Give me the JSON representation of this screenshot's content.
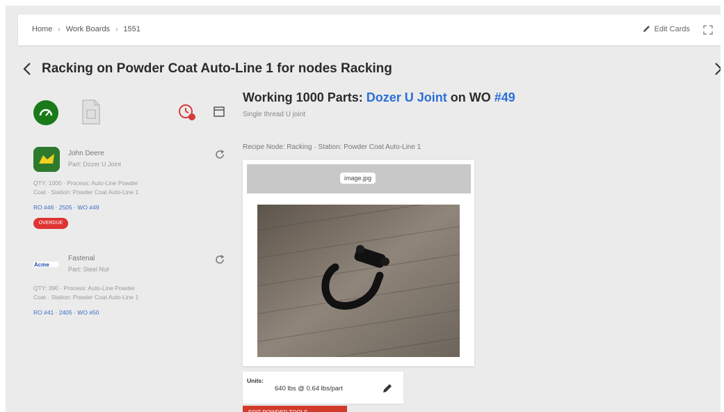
{
  "breadcrumb": {
    "home": "Home",
    "work_boards": "Work Boards",
    "board_id": "1551"
  },
  "header": {
    "edit_cards_label": "Edit Cards"
  },
  "title": "Racking on Powder Coat Auto-Line 1 for nodes Racking",
  "cards": [
    {
      "customer": "John Deere",
      "part": "Part: Dozer U Joint",
      "meta_line1": "QTY: 1000 · Process: Auto-Line Powder",
      "meta_line2": "Coat · Station: Powder Coat Auto-Line 1",
      "refs": "RO #46 · 2505 · WO #49",
      "badge": "OVERDUE"
    },
    {
      "customer": "Fastenal",
      "part": "Part: Steel Nut",
      "meta_line1": "QTY: 390 · Process: Auto-Line Powder",
      "meta_line2": "Coat · Station: Powder Coat Auto-Line 1",
      "refs": "RO #41 · 2405 · WO #50"
    }
  ],
  "main": {
    "heading_prefix": "Working 1000 Parts: ",
    "heading_part": "Dozer U Joint",
    "heading_mid": " on WO ",
    "heading_wo": "#49",
    "subtitle": "Single thread U joint",
    "recipe_line": "Recipe Node: Racking · Station: Powder Coat Auto-Line 1",
    "image_label": "image.jpg",
    "units_label": "Units:",
    "units_value": "640 lbs @ 0.64 lbs/part",
    "bottom_button": "EDIT POWDER TOOLS"
  },
  "colors": {
    "accent_blue": "#2a6fd6",
    "status_green": "#1a7a1a",
    "alert_red": "#e03434"
  },
  "icons": {
    "prev": "chevron-left-icon",
    "next": "chevron-right-icon",
    "edit": "pencil-icon",
    "expand": "expand-icon",
    "gauge": "gauge-icon",
    "document": "document-icon",
    "timer": "timer-alert-icon",
    "calendar": "calendar-icon",
    "refresh": "refresh-icon"
  }
}
